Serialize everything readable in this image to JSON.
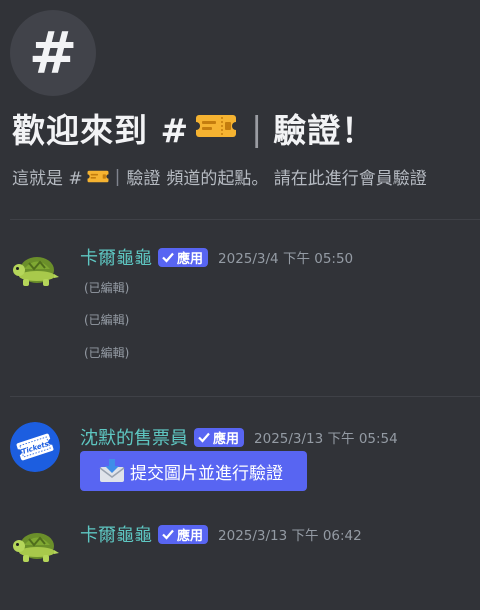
{
  "header": {
    "hash_symbol": "#",
    "welcome_prefix": "歡迎來到 #",
    "welcome_separator": "|",
    "welcome_channel": "驗證！",
    "desc_prefix": "這就是 #",
    "desc_separator": "|",
    "desc_channel": "驗證",
    "desc_suffix": "頻道的起點。 請在此進行會員驗證"
  },
  "messages": [
    {
      "username": "卡爾龜龜",
      "badge": "應用",
      "timestamp": "2025/3/4 下午 05:50",
      "avatar_icon": "turtle-icon",
      "edited": [
        "(已編輯)",
        "(已編輯)",
        "(已編輯)"
      ]
    },
    {
      "username": "沈默的售票員",
      "badge": "應用",
      "timestamp": "2025/3/13 下午 05:54",
      "avatar_icon": "ticket-icon",
      "avatar_text": "Tickets",
      "button": {
        "label": "提交圖片並進行驗證",
        "icon": "envelope-download-icon"
      }
    },
    {
      "username": "卡爾龜龜",
      "badge": "應用",
      "timestamp": "2025/3/13 下午 06:42",
      "avatar_icon": "turtle-icon"
    }
  ],
  "colors": {
    "background": "#313338",
    "username": "#5ec7c2",
    "badge": "#5865f2",
    "button": "#5865f2",
    "ticket_emoji": "#f5b331"
  }
}
